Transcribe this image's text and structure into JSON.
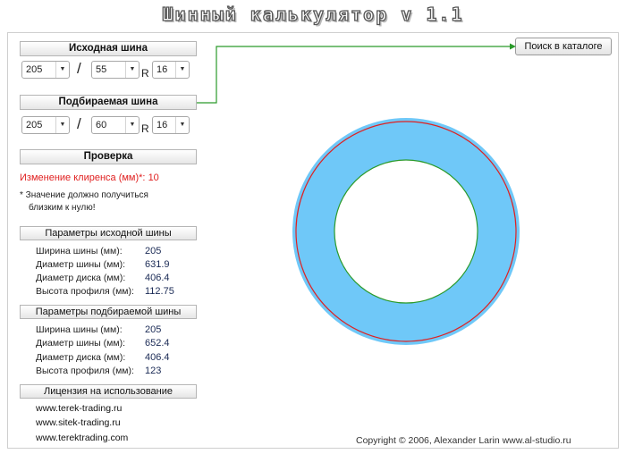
{
  "title": "Шинный калькулятор v 1.1",
  "source_tire": {
    "header": "Исходная шина",
    "width": "205",
    "profile": "55",
    "r_label": "R",
    "rim": "16"
  },
  "target_tire": {
    "header": "Подбираемая шина",
    "width": "205",
    "profile": "60",
    "r_label": "R",
    "rim": "16"
  },
  "check": {
    "header": "Проверка",
    "clearance_label": "Изменение клиренса (мм)*:",
    "clearance_value": "10",
    "note_line1": "* Значение должно получиться",
    "note_line2": "близким к нулю!"
  },
  "source_params": {
    "header": "Параметры исходной шины",
    "rows": [
      {
        "label": "Ширина шины (мм):",
        "value": "205"
      },
      {
        "label": "Диаметр шины (мм):",
        "value": "631.9"
      },
      {
        "label": "Диаметр диска (мм):",
        "value": "406.4"
      },
      {
        "label": "Высота профиля (мм):",
        "value": "112.75"
      }
    ]
  },
  "target_params": {
    "header": "Параметры подбираемой шины",
    "rows": [
      {
        "label": "Ширина шины (мм):",
        "value": "205"
      },
      {
        "label": "Диаметр шины (мм):",
        "value": "652.4"
      },
      {
        "label": "Диаметр диска (мм):",
        "value": "406.4"
      },
      {
        "label": "Высота профиля (мм):",
        "value": "123"
      }
    ]
  },
  "license": {
    "header": "Лицензия на использование",
    "links": [
      "www.terek-trading.ru",
      "www.sitek-trading.ru",
      "www.terektrading.com"
    ]
  },
  "catalog_button": "Поиск в каталоге",
  "copyright": "Copyright © 2006, Alexander Larin www.al-studio.ru",
  "colors": {
    "tire_fill": "#6fc8f8",
    "source_outline": "#e02020",
    "rim_outline": "#2a9a2a",
    "arrow": "#2a9a2a"
  }
}
